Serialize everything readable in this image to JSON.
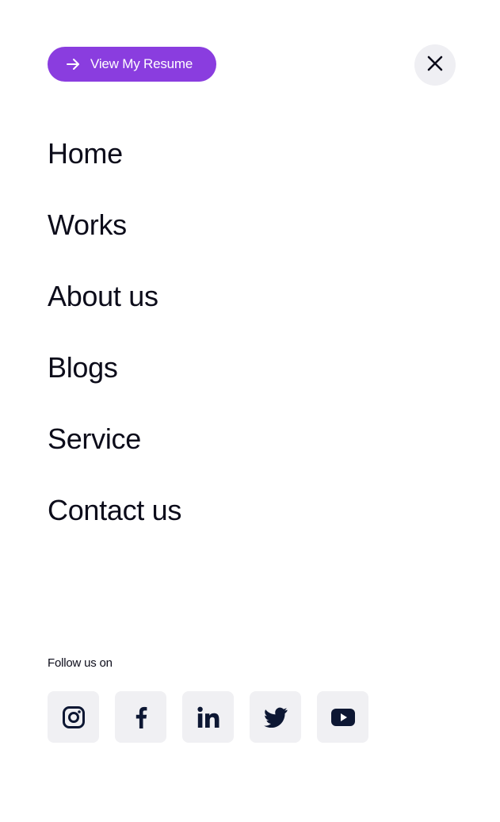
{
  "header": {
    "resume_button_label": "View My Resume",
    "resume_icon": "arrow-right-icon",
    "close_icon": "close-icon"
  },
  "nav": {
    "items": [
      {
        "label": "Home"
      },
      {
        "label": "Works"
      },
      {
        "label": "About us"
      },
      {
        "label": "Blogs"
      },
      {
        "label": "Service"
      },
      {
        "label": "Contact us"
      }
    ]
  },
  "social": {
    "heading": "Follow us on",
    "icons": [
      "instagram-icon",
      "facebook-icon",
      "linkedin-icon",
      "twitter-icon",
      "youtube-icon"
    ]
  },
  "colors": {
    "accent": "#8a3ddf",
    "text": "#0c0c1a",
    "icon": "#0d1733",
    "tile_bg": "#f0f0f3"
  }
}
